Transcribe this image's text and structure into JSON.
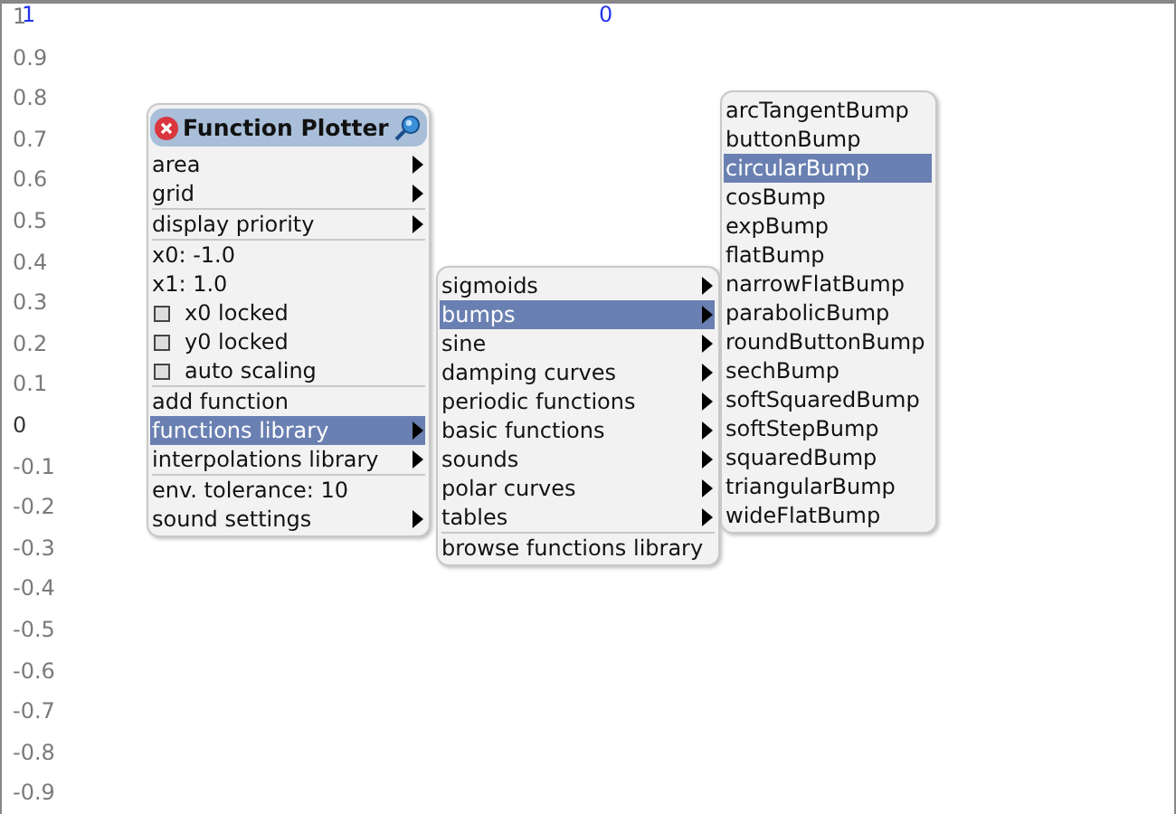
{
  "plot": {
    "y_labels": [
      {
        "text": "1",
        "kind": "minor"
      },
      {
        "text": "0.9",
        "kind": "minor"
      },
      {
        "text": "0.8",
        "kind": "minor"
      },
      {
        "text": "0.7",
        "kind": "minor"
      },
      {
        "text": "0.6",
        "kind": "minor"
      },
      {
        "text": "0.5",
        "kind": "minor"
      },
      {
        "text": "0.4",
        "kind": "minor"
      },
      {
        "text": "0.3",
        "kind": "minor"
      },
      {
        "text": "0.2",
        "kind": "minor"
      },
      {
        "text": "0.1",
        "kind": "minor"
      },
      {
        "text": "0",
        "kind": "zero"
      },
      {
        "text": "-0.1",
        "kind": "minor"
      },
      {
        "text": "-0.2",
        "kind": "minor"
      },
      {
        "text": "-0.3",
        "kind": "minor"
      },
      {
        "text": "-0.4",
        "kind": "minor"
      },
      {
        "text": "-0.5",
        "kind": "minor"
      },
      {
        "text": "-0.6",
        "kind": "minor"
      },
      {
        "text": "-0.7",
        "kind": "minor"
      },
      {
        "text": "-0.8",
        "kind": "minor"
      },
      {
        "text": "-0.9",
        "kind": "minor"
      }
    ],
    "x_labels": [
      {
        "text": "1"
      },
      {
        "text": "0"
      }
    ]
  },
  "menus": [
    {
      "title": "Function Plotter",
      "items": [
        {
          "kind": "submenu",
          "label": "area",
          "selected": false,
          "separator_before": false
        },
        {
          "kind": "submenu",
          "label": "grid",
          "selected": false,
          "separator_before": false
        },
        {
          "kind": "submenu",
          "label": "display priority",
          "selected": false,
          "separator_before": true
        },
        {
          "kind": "item",
          "label": "x0: -1.0",
          "selected": false,
          "separator_before": true
        },
        {
          "kind": "item",
          "label": "x1: 1.0",
          "selected": false,
          "separator_before": false
        },
        {
          "kind": "checkbox",
          "label": "x0 locked",
          "checked": false,
          "selected": false,
          "separator_before": false
        },
        {
          "kind": "checkbox",
          "label": "y0 locked",
          "checked": false,
          "selected": false,
          "separator_before": false
        },
        {
          "kind": "checkbox",
          "label": "auto scaling",
          "checked": false,
          "selected": false,
          "separator_before": false
        },
        {
          "kind": "item",
          "label": "add function",
          "selected": false,
          "separator_before": true
        },
        {
          "kind": "submenu",
          "label": "functions library",
          "selected": true,
          "separator_before": false
        },
        {
          "kind": "submenu",
          "label": "interpolations library",
          "selected": false,
          "separator_before": false
        },
        {
          "kind": "item",
          "label": "env. tolerance: 10",
          "selected": false,
          "separator_before": true
        },
        {
          "kind": "submenu",
          "label": "sound settings",
          "selected": false,
          "separator_before": false
        }
      ]
    },
    {
      "items": [
        {
          "kind": "submenu",
          "label": "sigmoids",
          "selected": false,
          "separator_before": false
        },
        {
          "kind": "submenu",
          "label": "bumps",
          "selected": true,
          "separator_before": false
        },
        {
          "kind": "submenu",
          "label": "sine",
          "selected": false,
          "separator_before": false
        },
        {
          "kind": "submenu",
          "label": "damping curves",
          "selected": false,
          "separator_before": false
        },
        {
          "kind": "submenu",
          "label": "periodic functions",
          "selected": false,
          "separator_before": false
        },
        {
          "kind": "submenu",
          "label": "basic functions",
          "selected": false,
          "separator_before": false
        },
        {
          "kind": "submenu",
          "label": "sounds",
          "selected": false,
          "separator_before": false
        },
        {
          "kind": "submenu",
          "label": "polar curves",
          "selected": false,
          "separator_before": false
        },
        {
          "kind": "submenu",
          "label": "tables",
          "selected": false,
          "separator_before": false
        },
        {
          "kind": "item",
          "label": "browse functions library",
          "selected": false,
          "separator_before": true
        }
      ]
    },
    {
      "items": [
        {
          "kind": "item",
          "label": "arcTangentBump",
          "selected": false,
          "separator_before": false
        },
        {
          "kind": "item",
          "label": "buttonBump",
          "selected": false,
          "separator_before": false
        },
        {
          "kind": "item",
          "label": "circularBump",
          "selected": true,
          "separator_before": false
        },
        {
          "kind": "item",
          "label": "cosBump",
          "selected": false,
          "separator_before": false
        },
        {
          "kind": "item",
          "label": "expBump",
          "selected": false,
          "separator_before": false
        },
        {
          "kind": "item",
          "label": "flatBump",
          "selected": false,
          "separator_before": false
        },
        {
          "kind": "item",
          "label": "narrowFlatBump",
          "selected": false,
          "separator_before": false
        },
        {
          "kind": "item",
          "label": "parabolicBump",
          "selected": false,
          "separator_before": false
        },
        {
          "kind": "item",
          "label": "roundButtonBump",
          "selected": false,
          "separator_before": false
        },
        {
          "kind": "item",
          "label": "sechBump",
          "selected": false,
          "separator_before": false
        },
        {
          "kind": "item",
          "label": "softSquaredBump",
          "selected": false,
          "separator_before": false
        },
        {
          "kind": "item",
          "label": "softStepBump",
          "selected": false,
          "separator_before": false
        },
        {
          "kind": "item",
          "label": "squaredBump",
          "selected": false,
          "separator_before": false
        },
        {
          "kind": "item",
          "label": "triangularBump",
          "selected": false,
          "separator_before": false
        },
        {
          "kind": "item",
          "label": "wideFlatBump",
          "selected": false,
          "separator_before": false
        }
      ]
    }
  ]
}
